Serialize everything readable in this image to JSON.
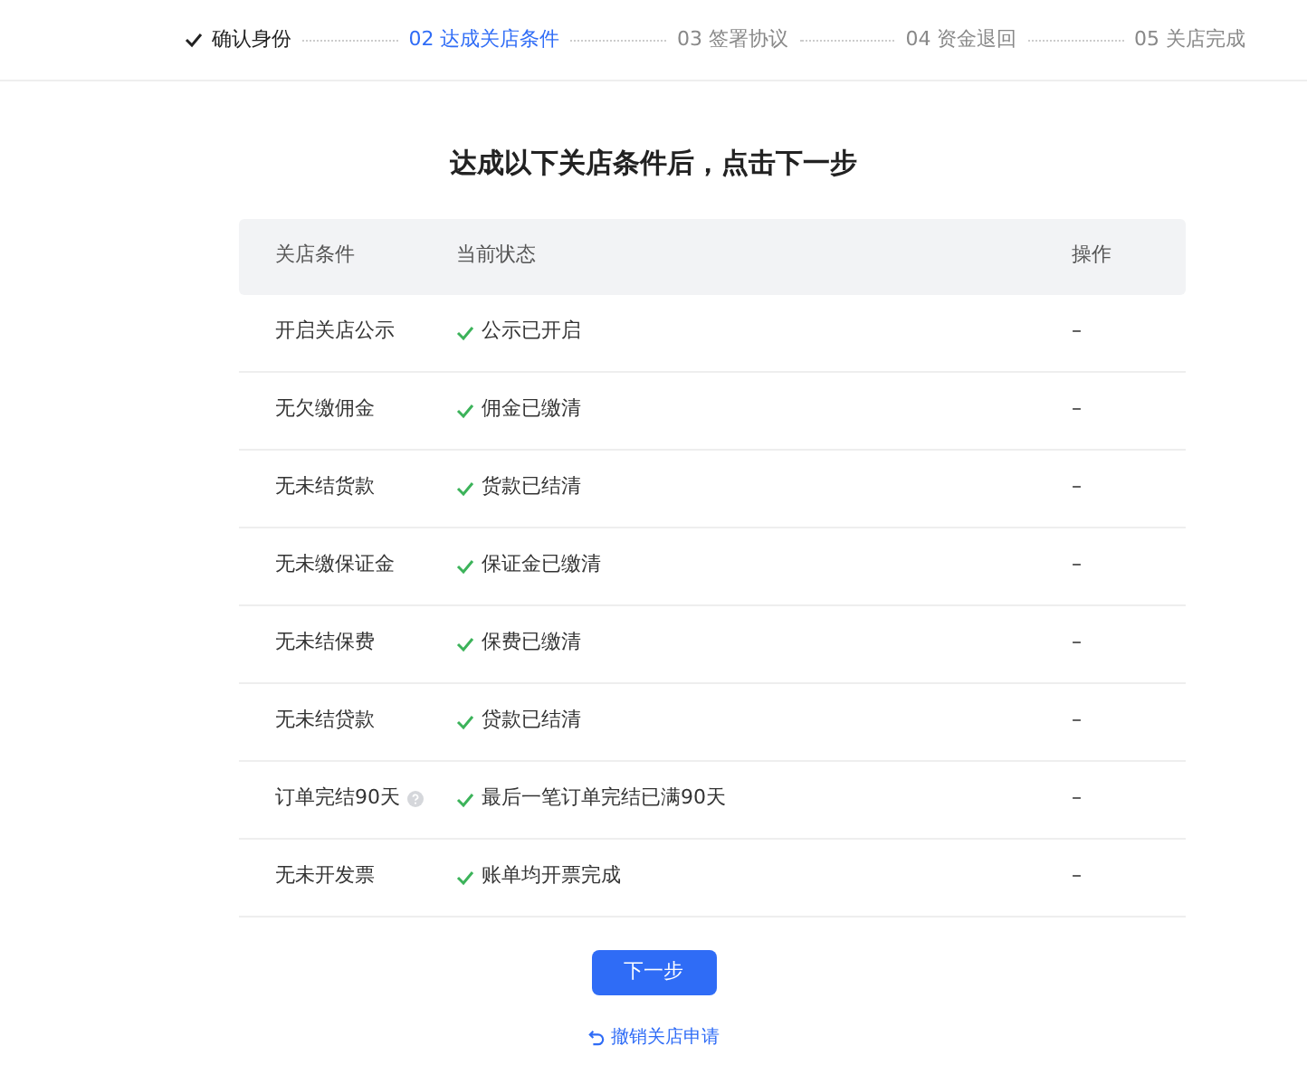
{
  "steps": [
    {
      "label": "确认身份",
      "done": true,
      "selected": false
    },
    {
      "label": "02 达成关店条件",
      "done": false,
      "selected": true
    },
    {
      "label": "03 签署协议",
      "done": false,
      "selected": false
    },
    {
      "label": "04 资金退回",
      "done": false,
      "selected": false
    },
    {
      "label": "05 关店完成",
      "done": false,
      "selected": false
    }
  ],
  "title": "达成以下关店条件后，点击下一步",
  "table": {
    "columns": [
      "关店条件",
      "当前状态",
      "操作"
    ],
    "rows": [
      {
        "condition": "开启关店公示",
        "help": false,
        "met": true,
        "status": "公示已开启",
        "action": "–"
      },
      {
        "condition": "无欠缴佣金",
        "help": false,
        "met": true,
        "status": "佣金已缴清",
        "action": "–"
      },
      {
        "condition": "无未结货款",
        "help": false,
        "met": true,
        "status": "货款已结清",
        "action": "–"
      },
      {
        "condition": "无未缴保证金",
        "help": false,
        "met": true,
        "status": "保证金已缴清",
        "action": "–"
      },
      {
        "condition": "无未结保费",
        "help": false,
        "met": true,
        "status": "保费已缴清",
        "action": "–"
      },
      {
        "condition": "无未结贷款",
        "help": false,
        "met": true,
        "status": "贷款已结清",
        "action": "–"
      },
      {
        "condition": "订单完结90天",
        "help": true,
        "met": true,
        "status": "最后一笔订单完结已满90天",
        "action": "–"
      },
      {
        "condition": "无未开发票",
        "help": false,
        "met": true,
        "status": "账单均开票完成",
        "action": "–"
      }
    ]
  },
  "next_button": "下一步",
  "cancel_link": "撤销关店申请"
}
